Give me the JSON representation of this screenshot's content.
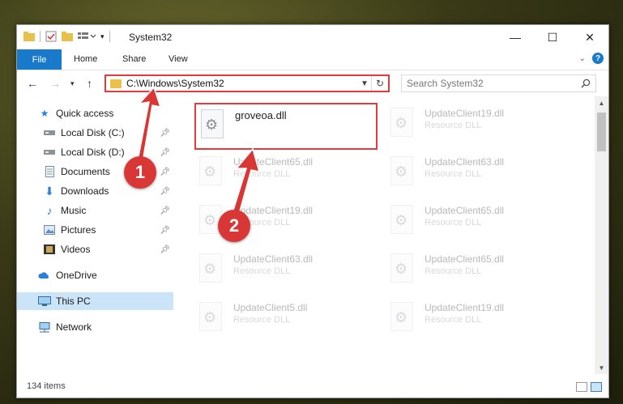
{
  "window": {
    "title": "System32",
    "controls": {
      "minimize": "—",
      "maximize": "☐",
      "close": "✕"
    }
  },
  "ribbon": {
    "file_tab": "File",
    "tabs": [
      "Home",
      "Share",
      "View"
    ],
    "help": "?"
  },
  "navigation": {
    "address_path": "C:\\Windows\\System32",
    "search_placeholder": "Search System32"
  },
  "sidebar": {
    "items": [
      {
        "label": "Quick access",
        "icon": "star-icon"
      },
      {
        "label": "Local Disk (C:)",
        "icon": "drive-icon",
        "pinned": true
      },
      {
        "label": "Local Disk (D:)",
        "icon": "drive-icon",
        "pinned": true
      },
      {
        "label": "Documents",
        "icon": "documents-icon",
        "pinned": true
      },
      {
        "label": "Downloads",
        "icon": "download-icon",
        "pinned": true
      },
      {
        "label": "Music",
        "icon": "music-icon",
        "pinned": true
      },
      {
        "label": "Pictures",
        "icon": "pictures-icon",
        "pinned": true
      },
      {
        "label": "Videos",
        "icon": "videos-icon",
        "pinned": true
      },
      {
        "label": "OneDrive",
        "icon": "cloud-icon"
      },
      {
        "label": "This PC",
        "icon": "computer-icon",
        "selected": true
      },
      {
        "label": "Network",
        "icon": "network-icon"
      }
    ]
  },
  "files": [
    {
      "name": "groveoa.dll",
      "type": ""
    },
    {
      "name": "UpdateClient19.dll",
      "type": "Resource DLL"
    },
    {
      "name": "UpdateClient65.dll",
      "type": "Resource DLL"
    },
    {
      "name": "UpdateClient63.dll",
      "type": "Resource DLL"
    },
    {
      "name": "UpdateClient19.dll",
      "type": "Resource DLL"
    },
    {
      "name": "UpdateClient65.dll",
      "type": "Resource DLL"
    },
    {
      "name": "UpdateClient63.dll",
      "type": "Resource DLL"
    },
    {
      "name": "UpdateClient65.dll",
      "type": "Resource DLL"
    },
    {
      "name": "UpdateClient5.dll",
      "type": "Resource DLL"
    },
    {
      "name": "UpdateClient19.dll",
      "type": "Resource DLL"
    }
  ],
  "status": {
    "item_count": "134 items"
  },
  "annotations": {
    "step1": "1",
    "step2": "2"
  },
  "colors": {
    "accent": "#1979ca",
    "highlight": "#e23b3b",
    "selected": "#cce4f7"
  }
}
